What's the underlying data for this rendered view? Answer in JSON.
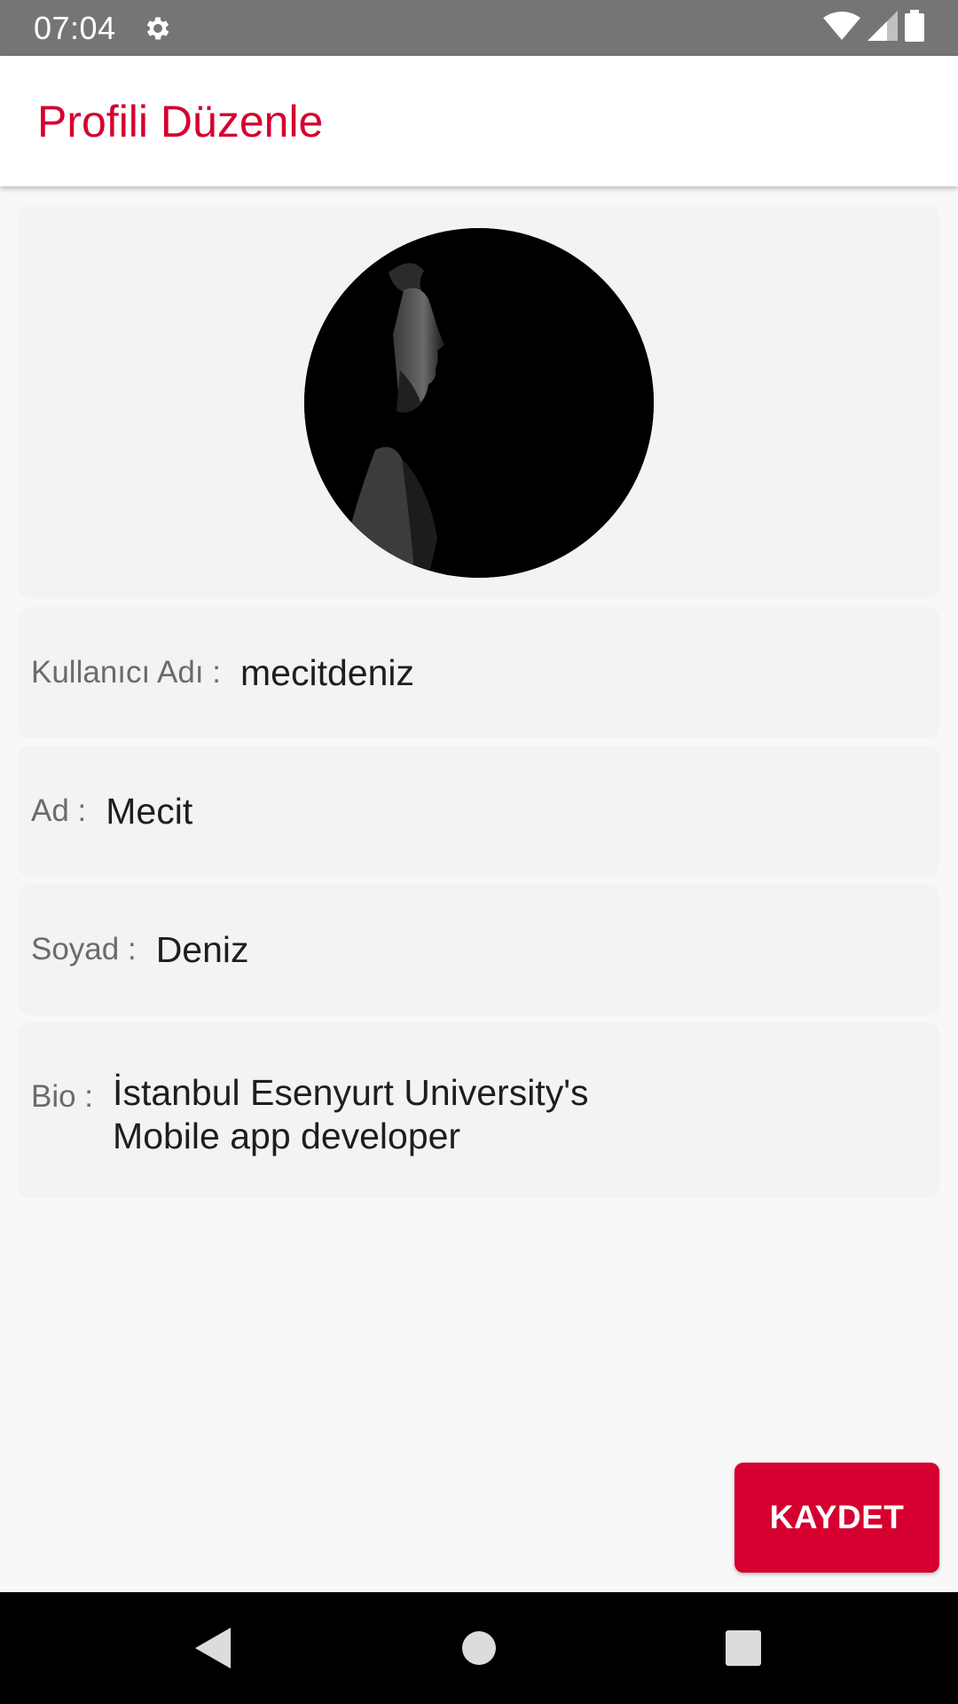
{
  "status_bar": {
    "time": "07:04",
    "icons": [
      "gear-icon",
      "wifi-icon",
      "cell-signal-icon",
      "battery-icon"
    ]
  },
  "app_bar": {
    "title": "Profili Düzenle"
  },
  "profile": {
    "avatar_icon": "profile-photo",
    "fields": {
      "username": {
        "label": "Kullanıcı Adı :",
        "value": "mecitdeniz"
      },
      "name": {
        "label": "Ad :",
        "value": "Mecit"
      },
      "surname": {
        "label": "Soyad :",
        "value": "Deniz"
      },
      "bio": {
        "label": "Bio :",
        "lines": [
          "İstanbul Esenyurt University's",
          "Mobile app developer"
        ]
      }
    }
  },
  "actions": {
    "save_label": "KAYDET"
  },
  "nav_bar": {
    "icons": [
      "back-icon",
      "home-icon",
      "recents-icon"
    ]
  },
  "colors": {
    "accent": "#d5002f",
    "status_bar": "#757575",
    "card_bg": "#f3f3f3",
    "page_bg": "#f8f8f8"
  }
}
